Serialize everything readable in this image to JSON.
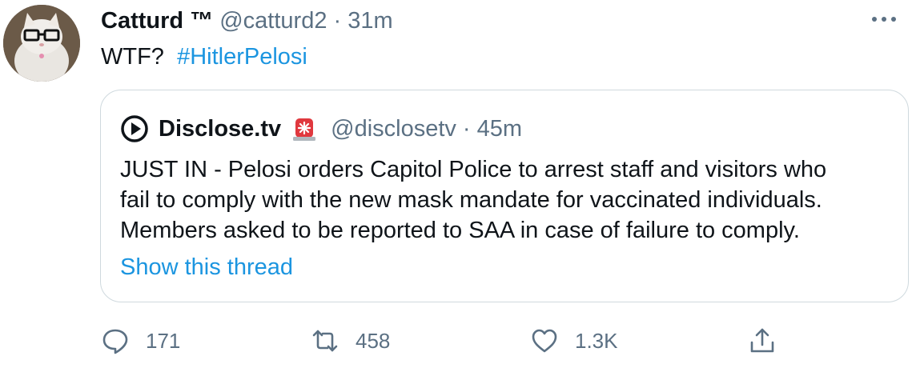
{
  "tweet": {
    "author_name": "Catturd ™",
    "author_handle": "@catturd2",
    "separator": "·",
    "time": "31m",
    "text_plain": "WTF?",
    "hashtag": "#HitlerPelosi",
    "more_icon": "more-dots-icon"
  },
  "quoted": {
    "author_name": "Disclose.tv",
    "author_handle": "@disclosetv",
    "separator": "·",
    "time": "45m",
    "body_lines": [
      "JUST IN - Pelosi orders Capitol Police to arrest staff and visitors who",
      "fail to comply with the new mask mandate for vaccinated individuals.",
      "Members asked to be reported to SAA in case of failure to comply."
    ],
    "show_thread": "Show this thread",
    "emoji_icon": "police-siren-icon"
  },
  "actions": {
    "replies": "171",
    "retweets": "458",
    "likes": "1.3K"
  },
  "colors": {
    "link": "#1b95e0",
    "muted": "#5b7083",
    "border": "#cfd9de"
  }
}
